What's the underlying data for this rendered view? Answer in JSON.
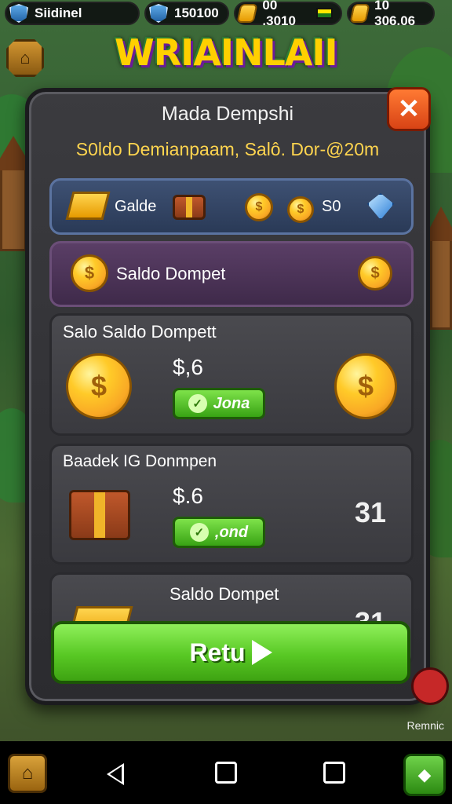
{
  "hud": {
    "player_name": "Siidinel",
    "stat_1": "150100",
    "stat_2": "00 .3010",
    "stat_3": "10 306.06"
  },
  "logo": {
    "text": "WRIAINLAII"
  },
  "modal": {
    "title": "Mada Dempshi",
    "subtitle": "S0ldo Demianpaam,  Salô. Dor-@20m",
    "close_label": "✕",
    "row_blue": {
      "label": "Galde",
      "value": "S0"
    },
    "row_purple": {
      "label": "Saldo Dompet"
    },
    "card_1": {
      "title": "Salo Saldo Dompett",
      "amount": "$,6",
      "button_label": "Jona"
    },
    "card_2": {
      "title": "Baadek IG Donmpen",
      "amount": "$.6",
      "button_label": ",ond",
      "count": "31"
    },
    "card_3": {
      "title": "Saldo Dompet",
      "count": "31"
    },
    "return_label": "Retu"
  },
  "side": {
    "label": "Remnic"
  },
  "icons": {
    "shield": "shield-icon",
    "gold": "gold-bar-icon",
    "coin": "coin-icon",
    "chest": "treasure-chest-icon",
    "gem": "gem-icon",
    "home": "home-icon",
    "check": "check-icon"
  },
  "colors": {
    "accent_green": "#58c824",
    "close_orange": "#d84315",
    "title_gold": "#ffd54f"
  }
}
